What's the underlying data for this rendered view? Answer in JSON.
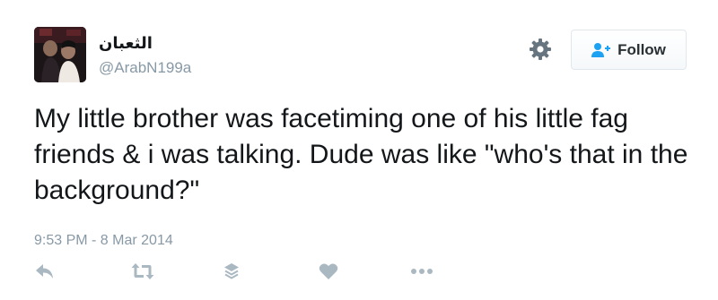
{
  "user": {
    "display_name": "الثعبان",
    "handle": "@ArabN199a"
  },
  "header": {
    "follow_label": "Follow",
    "icons": [
      "gear-icon",
      "follow-person-plus-icon"
    ]
  },
  "tweet": {
    "text": "My little brother was facetiming one of his little fag friends & i was talking. Dude was like \"who's that in the background?\"",
    "timestamp": "9:53 PM - 8 Mar 2014"
  },
  "actions": {
    "icons": [
      "reply-icon",
      "retweet-icon",
      "stack-icon",
      "like-heart-icon",
      "more-dots-icon"
    ]
  },
  "colors": {
    "text_primary": "#14171a",
    "text_secondary": "#8899a6",
    "icon_gray": "#aab8c2",
    "follow_icon_blue": "#1da1f2",
    "button_border": "#e1e8ed"
  }
}
